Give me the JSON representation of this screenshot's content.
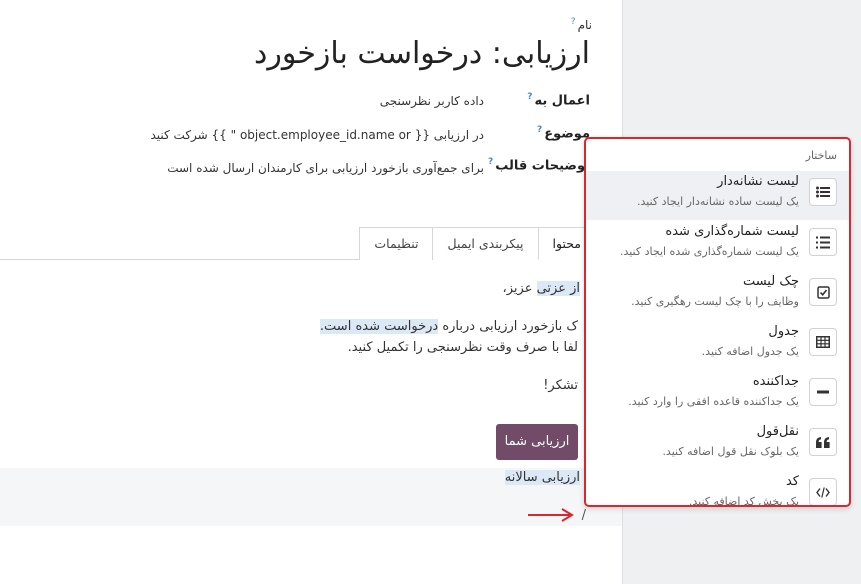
{
  "form": {
    "name_label": "نام",
    "title": "ارزیابی: درخواست بازخورد",
    "apply_to_label": "اعمال به",
    "apply_to_value": "داده کاربر نظرسنجی",
    "subject_label": "موضوع",
    "subject_value": "در ارزیابی {{ object.employee_id.name or \" }} شرکت کنید",
    "template_desc_label": "توضیحات قالب",
    "template_desc_value": "برای جمع‌آوری بازخورد ارزیابی برای کارمندان ارسال شده است",
    "help_mark": "?"
  },
  "tabs": [
    {
      "label": "محتوا",
      "active": true
    },
    {
      "label": "پیکربندی ایمیل",
      "active": false
    },
    {
      "label": "تنظیمات",
      "active": false
    }
  ],
  "content": {
    "greeting_a": "از عزتی",
    "greeting_b": "عزیز،",
    "line1_a": "ک بازخورد ارزیابی درباره",
    "line1_b": "درخواست شده است.",
    "line2": "لفا با صرف وقت نظرسنجی را تکمیل کنید.",
    "thanks": "تشکر!",
    "button_label": "ارزیابی شما",
    "footer_text": "ارزیابی سالانه",
    "slash": "/"
  },
  "popup": {
    "heading": "ساختار",
    "items": [
      {
        "title": "لیست نشانه‌دار",
        "desc": "یک لیست ساده نشانه‌دار ایجاد کنید.",
        "icon": "bulleted-list-icon"
      },
      {
        "title": "لیست شماره‌گذاری شده",
        "desc": "یک لیست شماره‌گذاری شده ایجاد کنید.",
        "icon": "numbered-list-icon"
      },
      {
        "title": "چک لیست",
        "desc": "وظایف را با چک لیست رهگیری کنید.",
        "icon": "checklist-icon"
      },
      {
        "title": "جدول",
        "desc": "یک جدول اضافه کنید.",
        "icon": "table-icon"
      },
      {
        "title": "جداکننده",
        "desc": "یک جداکننده قاعده افقی را وارد کنید.",
        "icon": "separator-icon"
      },
      {
        "title": "نقل‌قول",
        "desc": "یک بلوک نقل قول اضافه کنید.",
        "icon": "quote-icon"
      },
      {
        "title": "کد",
        "desc": "یک بخش کد اضافه کنید.",
        "icon": "code-icon"
      }
    ]
  },
  "colors": {
    "accent": "#714b67",
    "annotation": "#d9262f",
    "highlight": "#dbe9f7"
  }
}
